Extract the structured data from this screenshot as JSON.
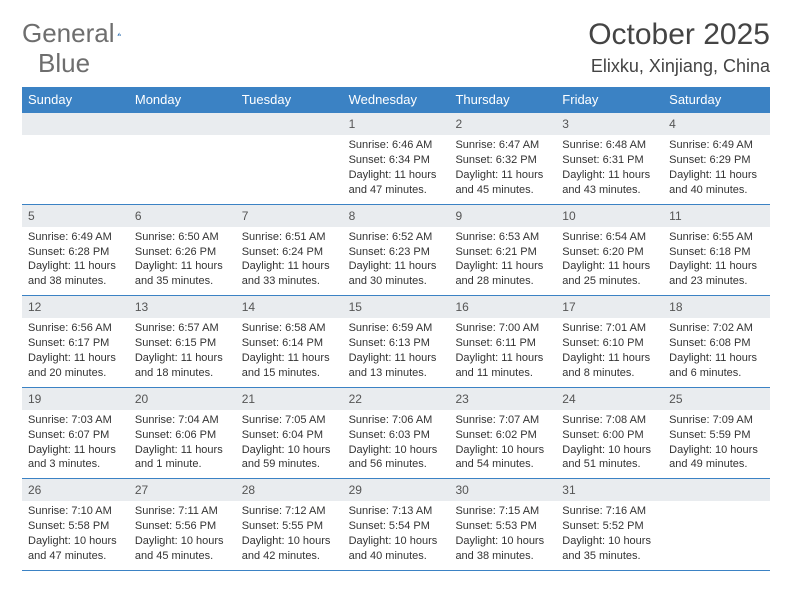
{
  "logo": {
    "text1": "General",
    "text2": "Blue"
  },
  "title": "October 2025",
  "location": "Elixku, Xinjiang, China",
  "day_names": [
    "Sunday",
    "Monday",
    "Tuesday",
    "Wednesday",
    "Thursday",
    "Friday",
    "Saturday"
  ],
  "weeks": [
    [
      {
        "n": "",
        "sr": "",
        "ss": "",
        "dl": ""
      },
      {
        "n": "",
        "sr": "",
        "ss": "",
        "dl": ""
      },
      {
        "n": "",
        "sr": "",
        "ss": "",
        "dl": ""
      },
      {
        "n": "1",
        "sr": "Sunrise: 6:46 AM",
        "ss": "Sunset: 6:34 PM",
        "dl": "Daylight: 11 hours and 47 minutes."
      },
      {
        "n": "2",
        "sr": "Sunrise: 6:47 AM",
        "ss": "Sunset: 6:32 PM",
        "dl": "Daylight: 11 hours and 45 minutes."
      },
      {
        "n": "3",
        "sr": "Sunrise: 6:48 AM",
        "ss": "Sunset: 6:31 PM",
        "dl": "Daylight: 11 hours and 43 minutes."
      },
      {
        "n": "4",
        "sr": "Sunrise: 6:49 AM",
        "ss": "Sunset: 6:29 PM",
        "dl": "Daylight: 11 hours and 40 minutes."
      }
    ],
    [
      {
        "n": "5",
        "sr": "Sunrise: 6:49 AM",
        "ss": "Sunset: 6:28 PM",
        "dl": "Daylight: 11 hours and 38 minutes."
      },
      {
        "n": "6",
        "sr": "Sunrise: 6:50 AM",
        "ss": "Sunset: 6:26 PM",
        "dl": "Daylight: 11 hours and 35 minutes."
      },
      {
        "n": "7",
        "sr": "Sunrise: 6:51 AM",
        "ss": "Sunset: 6:24 PM",
        "dl": "Daylight: 11 hours and 33 minutes."
      },
      {
        "n": "8",
        "sr": "Sunrise: 6:52 AM",
        "ss": "Sunset: 6:23 PM",
        "dl": "Daylight: 11 hours and 30 minutes."
      },
      {
        "n": "9",
        "sr": "Sunrise: 6:53 AM",
        "ss": "Sunset: 6:21 PM",
        "dl": "Daylight: 11 hours and 28 minutes."
      },
      {
        "n": "10",
        "sr": "Sunrise: 6:54 AM",
        "ss": "Sunset: 6:20 PM",
        "dl": "Daylight: 11 hours and 25 minutes."
      },
      {
        "n": "11",
        "sr": "Sunrise: 6:55 AM",
        "ss": "Sunset: 6:18 PM",
        "dl": "Daylight: 11 hours and 23 minutes."
      }
    ],
    [
      {
        "n": "12",
        "sr": "Sunrise: 6:56 AM",
        "ss": "Sunset: 6:17 PM",
        "dl": "Daylight: 11 hours and 20 minutes."
      },
      {
        "n": "13",
        "sr": "Sunrise: 6:57 AM",
        "ss": "Sunset: 6:15 PM",
        "dl": "Daylight: 11 hours and 18 minutes."
      },
      {
        "n": "14",
        "sr": "Sunrise: 6:58 AM",
        "ss": "Sunset: 6:14 PM",
        "dl": "Daylight: 11 hours and 15 minutes."
      },
      {
        "n": "15",
        "sr": "Sunrise: 6:59 AM",
        "ss": "Sunset: 6:13 PM",
        "dl": "Daylight: 11 hours and 13 minutes."
      },
      {
        "n": "16",
        "sr": "Sunrise: 7:00 AM",
        "ss": "Sunset: 6:11 PM",
        "dl": "Daylight: 11 hours and 11 minutes."
      },
      {
        "n": "17",
        "sr": "Sunrise: 7:01 AM",
        "ss": "Sunset: 6:10 PM",
        "dl": "Daylight: 11 hours and 8 minutes."
      },
      {
        "n": "18",
        "sr": "Sunrise: 7:02 AM",
        "ss": "Sunset: 6:08 PM",
        "dl": "Daylight: 11 hours and 6 minutes."
      }
    ],
    [
      {
        "n": "19",
        "sr": "Sunrise: 7:03 AM",
        "ss": "Sunset: 6:07 PM",
        "dl": "Daylight: 11 hours and 3 minutes."
      },
      {
        "n": "20",
        "sr": "Sunrise: 7:04 AM",
        "ss": "Sunset: 6:06 PM",
        "dl": "Daylight: 11 hours and 1 minute."
      },
      {
        "n": "21",
        "sr": "Sunrise: 7:05 AM",
        "ss": "Sunset: 6:04 PM",
        "dl": "Daylight: 10 hours and 59 minutes."
      },
      {
        "n": "22",
        "sr": "Sunrise: 7:06 AM",
        "ss": "Sunset: 6:03 PM",
        "dl": "Daylight: 10 hours and 56 minutes."
      },
      {
        "n": "23",
        "sr": "Sunrise: 7:07 AM",
        "ss": "Sunset: 6:02 PM",
        "dl": "Daylight: 10 hours and 54 minutes."
      },
      {
        "n": "24",
        "sr": "Sunrise: 7:08 AM",
        "ss": "Sunset: 6:00 PM",
        "dl": "Daylight: 10 hours and 51 minutes."
      },
      {
        "n": "25",
        "sr": "Sunrise: 7:09 AM",
        "ss": "Sunset: 5:59 PM",
        "dl": "Daylight: 10 hours and 49 minutes."
      }
    ],
    [
      {
        "n": "26",
        "sr": "Sunrise: 7:10 AM",
        "ss": "Sunset: 5:58 PM",
        "dl": "Daylight: 10 hours and 47 minutes."
      },
      {
        "n": "27",
        "sr": "Sunrise: 7:11 AM",
        "ss": "Sunset: 5:56 PM",
        "dl": "Daylight: 10 hours and 45 minutes."
      },
      {
        "n": "28",
        "sr": "Sunrise: 7:12 AM",
        "ss": "Sunset: 5:55 PM",
        "dl": "Daylight: 10 hours and 42 minutes."
      },
      {
        "n": "29",
        "sr": "Sunrise: 7:13 AM",
        "ss": "Sunset: 5:54 PM",
        "dl": "Daylight: 10 hours and 40 minutes."
      },
      {
        "n": "30",
        "sr": "Sunrise: 7:15 AM",
        "ss": "Sunset: 5:53 PM",
        "dl": "Daylight: 10 hours and 38 minutes."
      },
      {
        "n": "31",
        "sr": "Sunrise: 7:16 AM",
        "ss": "Sunset: 5:52 PM",
        "dl": "Daylight: 10 hours and 35 minutes."
      },
      {
        "n": "",
        "sr": "",
        "ss": "",
        "dl": ""
      }
    ]
  ]
}
